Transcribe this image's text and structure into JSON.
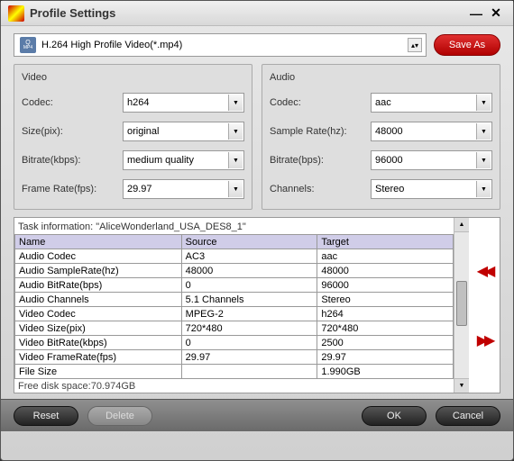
{
  "window": {
    "title": "Profile Settings"
  },
  "profile": {
    "selected": "H.264 High Profile Video(*.mp4)",
    "save_as_label": "Save As"
  },
  "video": {
    "section_title": "Video",
    "codec_label": "Codec:",
    "codec_value": "h264",
    "size_label": "Size(pix):",
    "size_value": "original",
    "bitrate_label": "Bitrate(kbps):",
    "bitrate_value": "medium quality",
    "framerate_label": "Frame Rate(fps):",
    "framerate_value": "29.97"
  },
  "audio": {
    "section_title": "Audio",
    "codec_label": "Codec:",
    "codec_value": "aac",
    "samplerate_label": "Sample Rate(hz):",
    "samplerate_value": "48000",
    "bitrate_label": "Bitrate(bps):",
    "bitrate_value": "96000",
    "channels_label": "Channels:",
    "channels_value": "Stereo"
  },
  "task": {
    "header_text": "Task information: \"AliceWonderland_USA_DES8_1\"",
    "columns": {
      "name": "Name",
      "source": "Source",
      "target": "Target"
    },
    "rows": [
      {
        "name": "Audio Codec",
        "source": "AC3",
        "target": "aac"
      },
      {
        "name": "Audio SampleRate(hz)",
        "source": "48000",
        "target": "48000"
      },
      {
        "name": "Audio BitRate(bps)",
        "source": "0",
        "target": "96000"
      },
      {
        "name": "Audio Channels",
        "source": "5.1 Channels",
        "target": "Stereo"
      },
      {
        "name": "Video Codec",
        "source": "MPEG-2",
        "target": "h264"
      },
      {
        "name": "Video Size(pix)",
        "source": "720*480",
        "target": "720*480"
      },
      {
        "name": "Video BitRate(kbps)",
        "source": "0",
        "target": "2500"
      },
      {
        "name": "Video FrameRate(fps)",
        "source": "29.97",
        "target": "29.97"
      },
      {
        "name": "File Size",
        "source": "",
        "target": "1.990GB"
      }
    ],
    "free_disk": "Free disk space:70.974GB"
  },
  "buttons": {
    "reset": "Reset",
    "delete": "Delete",
    "ok": "OK",
    "cancel": "Cancel"
  }
}
